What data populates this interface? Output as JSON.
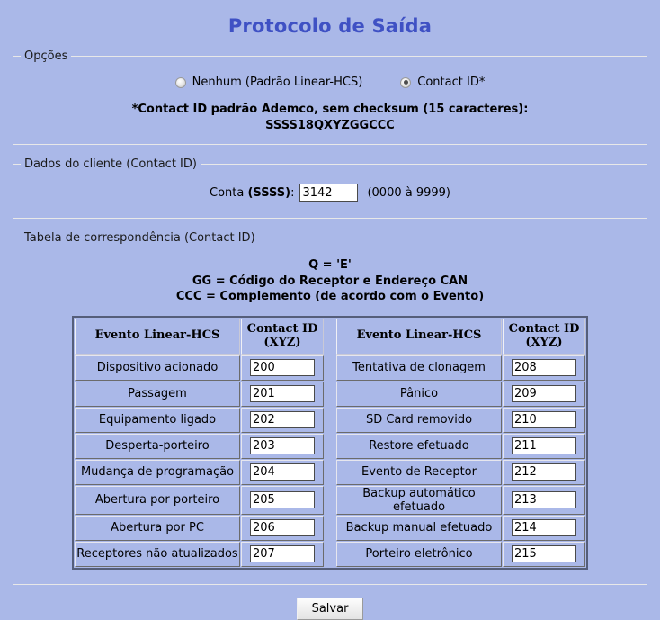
{
  "page": {
    "title": "Protocolo de Saída",
    "title_color": "#3f51c4",
    "background_color": "#aab8e8"
  },
  "options": {
    "legend": "Opções",
    "radios": [
      {
        "label": "Nenhum (Padrão Linear-HCS)",
        "checked": false
      },
      {
        "label": "Contact ID*",
        "checked": true
      }
    ],
    "note_line1": "*Contact ID padrão Ademco, sem checksum (15 caracteres):",
    "note_line2": "SSSS18QXYZGGCCC"
  },
  "client": {
    "legend": "Dados do cliente (Contact ID)",
    "field_label_prefix": "Conta ",
    "field_label_bold": "(SSSS)",
    "field_label_suffix": ":",
    "account_value": "3142",
    "range_hint": "(0000 à 9999)"
  },
  "table_section": {
    "legend": "Tabela de correspondência (Contact ID)",
    "legend_lines": [
      "Q = 'E'",
      "GG = Código do Receptor e Endereço CAN",
      "CCC = Complemento (de acordo com o Evento)"
    ],
    "headers": {
      "event_left": "Evento Linear-HCS",
      "code_left_l1": "Contact ID",
      "code_left_l2": "(XYZ)",
      "event_right": "Evento Linear-HCS",
      "code_right_l1": "Contact ID",
      "code_right_l2": "(XYZ)"
    },
    "rows": [
      {
        "left_event": "Dispositivo acionado",
        "left_code": "200",
        "right_event": "Tentativa de clonagem",
        "right_code": "208"
      },
      {
        "left_event": "Passagem",
        "left_code": "201",
        "right_event": "Pânico",
        "right_code": "209"
      },
      {
        "left_event": "Equipamento ligado",
        "left_code": "202",
        "right_event": "SD Card removido",
        "right_code": "210"
      },
      {
        "left_event": "Desperta-porteiro",
        "left_code": "203",
        "right_event": "Restore efetuado",
        "right_code": "211"
      },
      {
        "left_event": "Mudança de programação",
        "left_code": "204",
        "right_event": "Evento de Receptor",
        "right_code": "212"
      },
      {
        "left_event": "Abertura por porteiro",
        "left_code": "205",
        "right_event": "Backup automático efetuado",
        "right_code": "213"
      },
      {
        "left_event": "Abertura por PC",
        "left_code": "206",
        "right_event": "Backup manual efetuado",
        "right_code": "214"
      },
      {
        "left_event": "Receptores não atualizados",
        "left_code": "207",
        "right_event": "Porteiro eletrônico",
        "right_code": "215"
      }
    ]
  },
  "footer": {
    "save_label": "Salvar"
  }
}
